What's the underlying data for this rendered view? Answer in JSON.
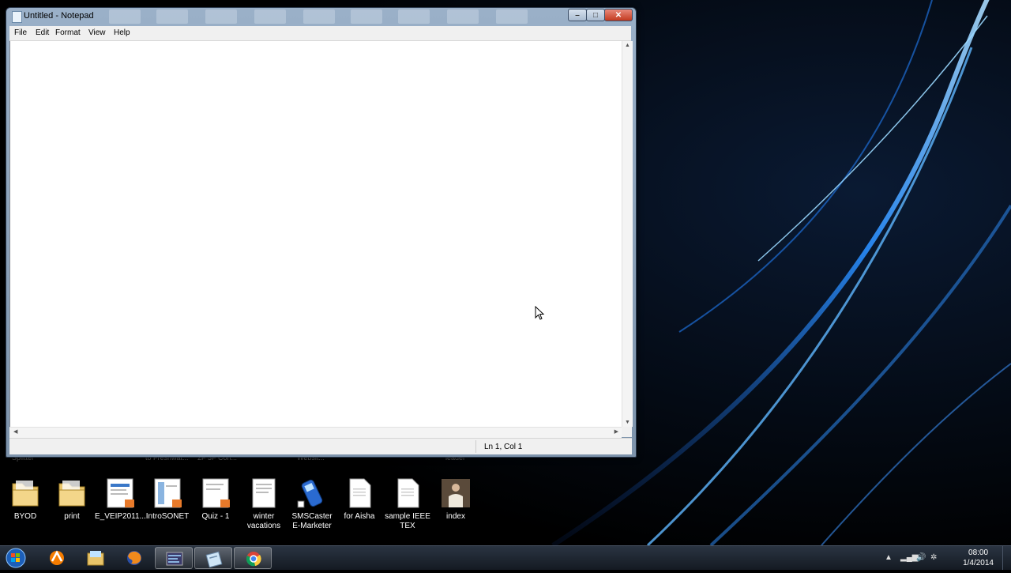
{
  "window": {
    "title": "Untitled - Notepad",
    "minimize_label": "–",
    "maximize_label": "□",
    "close_label": "✕"
  },
  "menu": {
    "file": "File",
    "edit": "Edit",
    "format": "Format",
    "view": "View",
    "help": "Help"
  },
  "editor": {
    "content": ""
  },
  "status": {
    "position": "Ln 1, Col 1"
  },
  "desktop": {
    "icons": [
      {
        "label": "BYOD",
        "icon": "folder-icon"
      },
      {
        "label": "print",
        "icon": "folder-icon"
      },
      {
        "label": "E_VEIP2011...",
        "icon": "pdf-document-icon"
      },
      {
        "label": "IntroSONET",
        "icon": "pdf-document-icon"
      },
      {
        "label": "Quiz - 1",
        "icon": "pdf-document-icon"
      },
      {
        "label": "winter\nvacations",
        "icon": "document-icon"
      },
      {
        "label": "SMSCaster\nE-Marketer",
        "icon": "phone-app-icon"
      },
      {
        "label": "for Aisha",
        "icon": "text-file-icon"
      },
      {
        "label": "sample IEEE\nTEX",
        "icon": "text-file-icon"
      },
      {
        "label": "index",
        "icon": "image-thumbnail-icon"
      }
    ]
  },
  "taskbar": {
    "clock_time": "08:00",
    "clock_date": "1/4/2014",
    "apps": [
      "start-orb-icon",
      "avast-icon",
      "file-explorer-icon",
      "firefox-icon",
      "monitor-app-icon",
      "notepad-icon",
      "chrome-icon"
    ]
  }
}
